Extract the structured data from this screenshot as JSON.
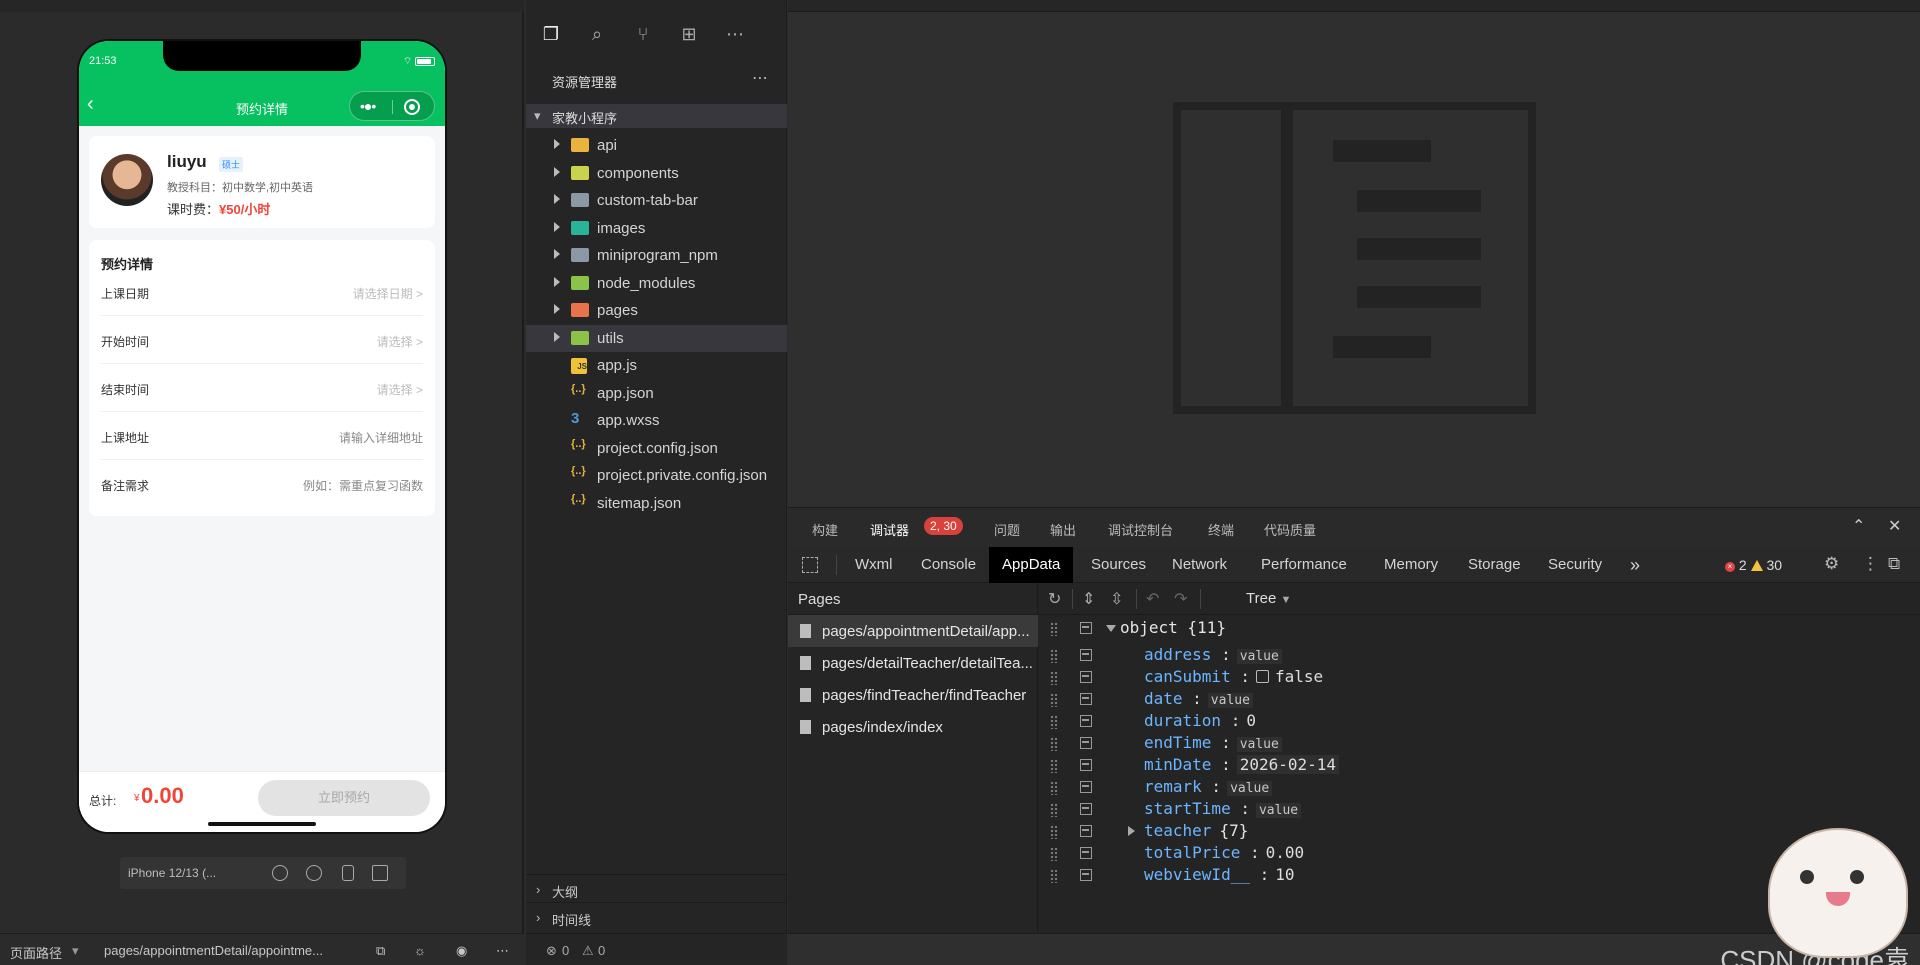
{
  "simulator": {
    "status_time": "21:53",
    "nav_title": "预约详情",
    "teacher": {
      "name": "liuyu",
      "badge": "硕士",
      "subjects": "教授科目：初中数学,初中英语",
      "fee_label": "课时费：",
      "fee_value": "¥50/小时"
    },
    "form": {
      "title": "预约详情",
      "rows": [
        {
          "label": "上课日期",
          "value": "请选择日期 >"
        },
        {
          "label": "开始时间",
          "value": "请选择 >"
        },
        {
          "label": "结束时间",
          "value": "请选择 >"
        },
        {
          "label": "上课地址",
          "value": "请输入详细地址"
        },
        {
          "label": "备注需求",
          "value": "例如：需重点复习函数"
        }
      ]
    },
    "bottom": {
      "total_label": "总计:",
      "currency": "¥",
      "total_value": "0.00",
      "book_button": "立即预约"
    },
    "device": "iPhone 12/13 (...",
    "footer": {
      "path_label": "页面路径",
      "path_value": "pages/appointmentDetail/appointme..."
    }
  },
  "explorer": {
    "header": "资源管理器",
    "project": "家教小程序",
    "items": [
      {
        "name": "api",
        "type": "folder",
        "color": "#e8b33f"
      },
      {
        "name": "components",
        "type": "folder",
        "color": "#c9d34b"
      },
      {
        "name": "custom-tab-bar",
        "type": "folder",
        "color": "#8b98a6"
      },
      {
        "name": "images",
        "type": "folder",
        "color": "#2bb39a"
      },
      {
        "name": "miniprogram_npm",
        "type": "folder",
        "color": "#8b98a6"
      },
      {
        "name": "node_modules",
        "type": "folder",
        "color": "#8bc34a"
      },
      {
        "name": "pages",
        "type": "folder",
        "color": "#e8734a"
      },
      {
        "name": "utils",
        "type": "folder",
        "color": "#8bc34a"
      },
      {
        "name": "app.js",
        "type": "js"
      },
      {
        "name": "app.json",
        "type": "json"
      },
      {
        "name": "app.wxss",
        "type": "css"
      },
      {
        "name": "project.config.json",
        "type": "json"
      },
      {
        "name": "project.private.config.json",
        "type": "json"
      },
      {
        "name": "sitemap.json",
        "type": "json"
      }
    ],
    "outline_label": "大纲",
    "timeline_label": "时间线",
    "status": {
      "errors": "0",
      "warnings": "0"
    }
  },
  "panel": {
    "tabs": [
      "构建",
      "调试器",
      "问题",
      "输出",
      "调试控制台",
      "终端",
      "代码质量"
    ],
    "debugger_badge": "2, 30",
    "devtools_tabs": [
      "Wxml",
      "Console",
      "AppData",
      "Sources",
      "Network",
      "Performance",
      "Memory",
      "Storage",
      "Security"
    ],
    "more_tabs": "»",
    "error_count": "2",
    "warning_count": "30"
  },
  "appdata": {
    "pages_header": "Pages",
    "pages": [
      "pages/appointmentDetail/app...",
      "pages/detailTeacher/detailTea...",
      "pages/findTeacher/findTeacher",
      "pages/index/index"
    ],
    "view_mode": "Tree",
    "root": "object {11}",
    "fields": [
      {
        "key": "address",
        "value": "value",
        "kind": "placeholder"
      },
      {
        "key": "canSubmit",
        "value": "false",
        "kind": "bool"
      },
      {
        "key": "date",
        "value": "value",
        "kind": "placeholder"
      },
      {
        "key": "duration",
        "value": "0",
        "kind": "number"
      },
      {
        "key": "endTime",
        "value": "value",
        "kind": "placeholder"
      },
      {
        "key": "minDate",
        "value": "2026-02-14",
        "kind": "string"
      },
      {
        "key": "remark",
        "value": "value",
        "kind": "placeholder"
      },
      {
        "key": "startTime",
        "value": "value",
        "kind": "placeholder"
      },
      {
        "key": "teacher",
        "value": "{7}",
        "kind": "object"
      },
      {
        "key": "totalPrice",
        "value": "0.00",
        "kind": "number"
      },
      {
        "key": "webviewId__",
        "value": "10",
        "kind": "number"
      }
    ]
  },
  "watermark": "CSDN @code袁"
}
